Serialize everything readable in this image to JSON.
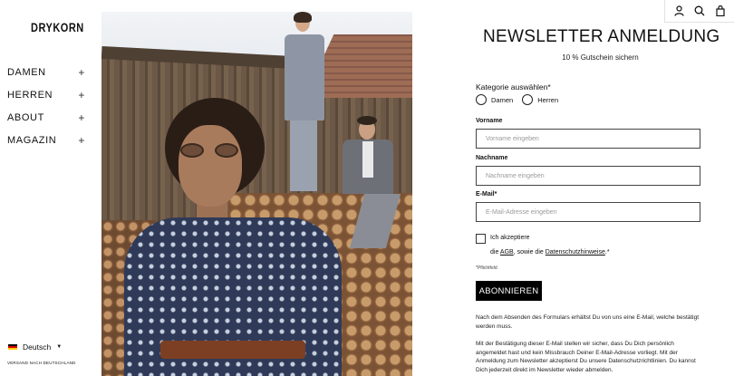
{
  "brand": {
    "logo": "DRYKORN"
  },
  "nav": {
    "items": [
      {
        "label": "DAMEN",
        "toggle": "+"
      },
      {
        "label": "HERREN",
        "toggle": "+"
      },
      {
        "label": "ABOUT",
        "toggle": "+"
      },
      {
        "label": "MAGAZIN",
        "toggle": "+"
      }
    ]
  },
  "footer": {
    "language": "Deutsch",
    "shipping": "VERSAND NACH DEUTSCHLAND"
  },
  "header_icons": [
    "user-icon",
    "search-icon",
    "shopping-bag-icon"
  ],
  "colors": {
    "accent": "#000000",
    "text": "#111111",
    "input_border": "#444444",
    "placeholder": "#9a9a9a"
  },
  "form": {
    "title": "NEWSLETTER ANMELDUNG",
    "subtitle": "10 % Gutschein sichern",
    "category_label": "Kategorie auswählen*",
    "category_options": [
      "Damen",
      "Herren"
    ],
    "fields": [
      {
        "label": "Vorname",
        "placeholder": "Vorname eingeben"
      },
      {
        "label": "Nachname",
        "placeholder": "Nachname eingeben"
      },
      {
        "label": "E-Mail*",
        "placeholder": "E-Mail-Adresse eingeben"
      }
    ],
    "consent_line1": "Ich akzeptiere",
    "consent_pre": "die ",
    "consent_agb": "AGB",
    "consent_mid": ", sowie die ",
    "consent_privacy": "Datenschutzhinweise",
    "consent_post": ".*",
    "required_note": "*Pflichtfeld",
    "submit_label": "ABONNIEREN",
    "info_1": "Nach dem Absenden des Formulars erhältst Du von uns eine E-Mail, welche bestätigt werden muss.",
    "info_2": "Mit der Bestätigung dieser E-Mail stellen wir sicher, dass Du Dich persönlich angemeldet hast und kein Missbrauch Deiner E-Mail-Adresse vorliegt. Mit der Anmeldung zum Newsletter akzeptierst Du unsere Datenschutzrichtlinien. Du kannst Dich jederzeit direkt im Newsletter wieder abmelden."
  }
}
